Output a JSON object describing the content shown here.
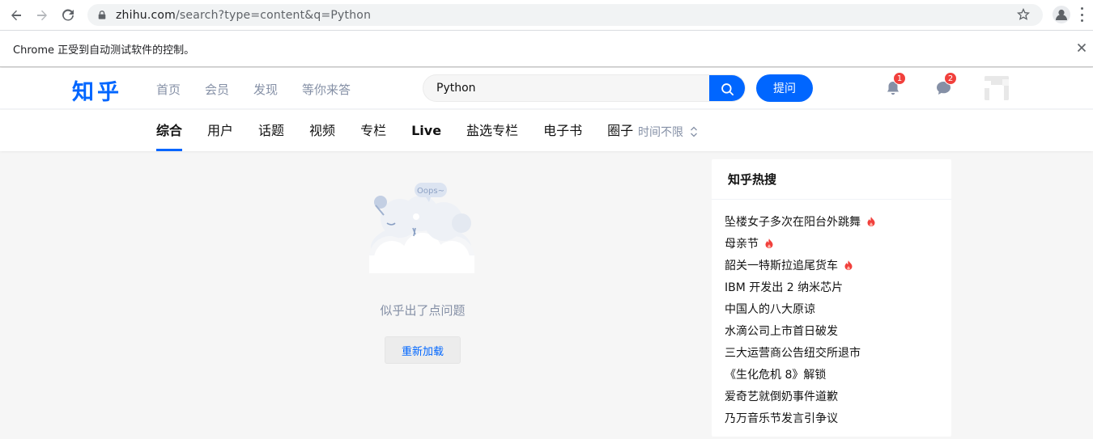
{
  "browser": {
    "url_host": "zhihu.com",
    "url_rest": "/search?type=content&q=Python",
    "infobar_message": "Chrome 正受到自动测试软件的控制。"
  },
  "header": {
    "logo": "知乎",
    "nav": [
      "首页",
      "会员",
      "发现",
      "等你来答"
    ],
    "search_value": "Python",
    "ask_label": "提问",
    "notification_count": "1",
    "message_count": "2"
  },
  "tabs": {
    "items": [
      "综合",
      "用户",
      "话题",
      "视频",
      "专栏",
      "Live",
      "盐选专栏",
      "电子书",
      "圈子"
    ],
    "active": "综合",
    "time_filter": "时间不限"
  },
  "main": {
    "illustration_text": "Oops~",
    "error_message": "似乎出了点问题",
    "reload_label": "重新加载"
  },
  "hot_search": {
    "title": "知乎热搜",
    "items": [
      {
        "text": "坠楼女子多次在阳台外跳舞",
        "hot": true
      },
      {
        "text": "母亲节",
        "hot": true
      },
      {
        "text": "韶关一特斯拉追尾货车",
        "hot": true
      },
      {
        "text": "IBM 开发出 2 纳米芯片",
        "hot": false
      },
      {
        "text": "中国人的八大原谅",
        "hot": false
      },
      {
        "text": "水滴公司上市首日破发",
        "hot": false
      },
      {
        "text": "三大运营商公告纽交所退市",
        "hot": false
      },
      {
        "text": "《生化危机 8》解锁",
        "hot": false
      },
      {
        "text": "爱奇艺就倒奶事件道歉",
        "hot": false
      },
      {
        "text": "乃万音乐节发言引争议",
        "hot": false
      }
    ]
  },
  "colors": {
    "brand": "#0066ff",
    "badge": "#f1403c",
    "hot_fire": "#f1403c",
    "muted": "#8590a6"
  }
}
